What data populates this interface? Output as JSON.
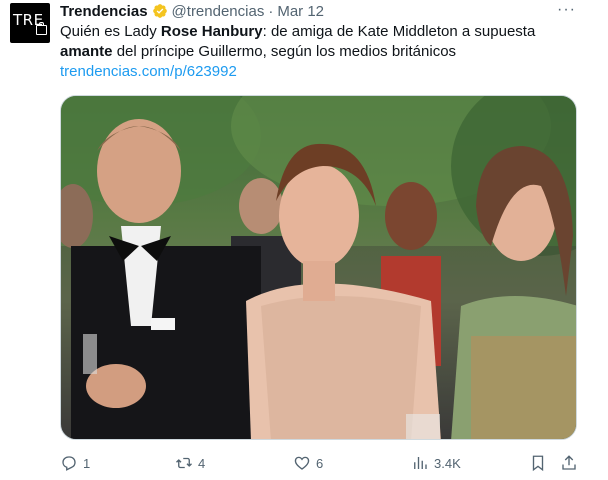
{
  "tweet": {
    "avatar_text": "TRE",
    "name": "Trendencias",
    "handle": "@trendencias",
    "separator": "·",
    "date": "Mar 12",
    "more": "···",
    "text": {
      "part1": "Quién es Lady ",
      "bold1": "Rose Hanbury",
      "part2": ": de amiga de Kate Middleton a supuesta ",
      "bold2": "amante",
      "part3": " del príncipe Guillermo, según los medios británicos",
      "link": "trendencias.com/p/623992"
    },
    "stats": {
      "replies": "1",
      "retweets": "4",
      "likes": "6",
      "views": "3.4K"
    },
    "icons": {
      "verified": "verified-badge-icon",
      "reply": "reply-icon",
      "retweet": "retweet-icon",
      "like": "heart-icon",
      "views": "views-chart-icon",
      "bookmark": "bookmark-icon",
      "share": "share-icon"
    },
    "colors": {
      "verified": "#f4c41f",
      "link": "#1d9bf0",
      "muted": "#536471"
    }
  }
}
